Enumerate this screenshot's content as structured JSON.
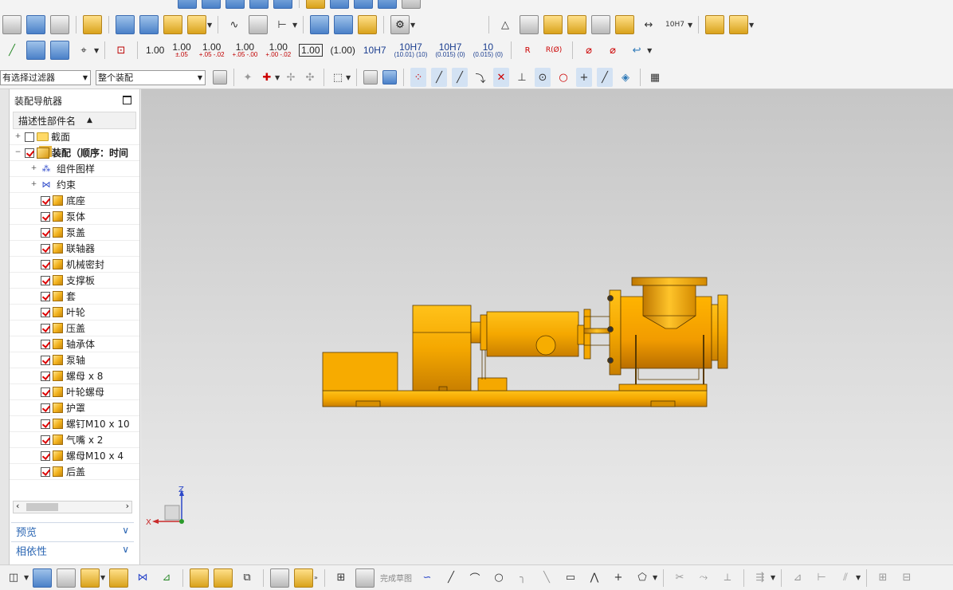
{
  "toolbar": {
    "row1_icons": [
      "sheet-icon",
      "book-icon",
      "layers-icon",
      "cube-blue-icon",
      "cube-blue-icon",
      "cube-blue-icon",
      "sheet-icon",
      "gold-cube-icon",
      "gold-cube-icon",
      "view-icon",
      "view-icon"
    ],
    "row2_tolerance_label": "10H7",
    "row3_tolerances": [
      {
        "main": "1.00",
        "sub": ""
      },
      {
        "main": "1.00",
        "sub": "±.05"
      },
      {
        "main": "1.00",
        "sub": "+.05 -.02"
      },
      {
        "main": "1.00",
        "sub": "+.05 -.00"
      },
      {
        "main": "1.00",
        "sub": "+.00 -.02"
      },
      {
        "main": "1.00",
        "sub": ""
      },
      {
        "main": "(1.00)",
        "sub": ""
      },
      {
        "main": "10H7",
        "sub": ""
      },
      {
        "main": "10H7",
        "sub": "(10.01) (10)"
      },
      {
        "main": "10H7",
        "sub": "(0.015) (0)"
      },
      {
        "main": "10",
        "sub": "(0.015) (0)"
      }
    ],
    "radius_labels": [
      "R",
      "R(Ø)"
    ],
    "filter_select": "有选择过滤器",
    "scope_select": "整个装配"
  },
  "navigator": {
    "title": "装配导航器",
    "column_header": "描述性部件名",
    "items": [
      {
        "label": "截面",
        "checked": false,
        "icon": "folder-icon",
        "expander": "+",
        "indent": 0
      },
      {
        "label": "装配（顺序：时间",
        "checked": true,
        "icon": "assembly-icon",
        "expander": "−",
        "indent": 0,
        "bold": true
      },
      {
        "label": "组件图样",
        "checked": null,
        "icon": "component-pattern-icon",
        "expander": "+",
        "indent": 1
      },
      {
        "label": "约束",
        "checked": null,
        "icon": "constraint-icon",
        "expander": "+",
        "indent": 1
      },
      {
        "label": "底座",
        "checked": true,
        "icon": "part-icon",
        "indent": 1
      },
      {
        "label": "泵体",
        "checked": true,
        "icon": "part-icon",
        "indent": 1
      },
      {
        "label": "泵盖",
        "checked": true,
        "icon": "part-icon",
        "indent": 1
      },
      {
        "label": "联轴器",
        "checked": true,
        "icon": "part-icon",
        "indent": 1
      },
      {
        "label": "机械密封",
        "checked": true,
        "icon": "part-icon",
        "indent": 1
      },
      {
        "label": "支撑板",
        "checked": true,
        "icon": "part-icon",
        "indent": 1
      },
      {
        "label": "套",
        "checked": true,
        "icon": "part-icon",
        "indent": 1
      },
      {
        "label": "叶轮",
        "checked": true,
        "icon": "part-icon",
        "indent": 1
      },
      {
        "label": "压盖",
        "checked": true,
        "icon": "part-icon",
        "indent": 1
      },
      {
        "label": "轴承体",
        "checked": true,
        "icon": "part-icon",
        "indent": 1
      },
      {
        "label": "泵轴",
        "checked": true,
        "icon": "part-icon",
        "indent": 1
      },
      {
        "label": "螺母 x 8",
        "checked": true,
        "icon": "part-icon",
        "indent": 1
      },
      {
        "label": "叶轮螺母",
        "checked": true,
        "icon": "part-icon",
        "indent": 1
      },
      {
        "label": "护罩",
        "checked": true,
        "icon": "part-icon",
        "indent": 1
      },
      {
        "label": "螺钉M10 x 10",
        "checked": true,
        "icon": "part-icon",
        "indent": 1
      },
      {
        "label": "气嘴 x 2",
        "checked": true,
        "icon": "part-icon",
        "indent": 1
      },
      {
        "label": "螺母M10 x 4",
        "checked": true,
        "icon": "part-icon",
        "indent": 1
      },
      {
        "label": "后盖",
        "checked": true,
        "icon": "part-icon",
        "indent": 1
      }
    ],
    "panels": [
      "预览",
      "相依性"
    ]
  },
  "viewport": {
    "triad": {
      "x_label": "X",
      "z_label": "Z"
    },
    "model_color": "#f5a800"
  },
  "bottom_bar": {
    "finish_sketch_label": "完成草图"
  },
  "colors": {
    "accent_blue": "#2b66b3",
    "check_red": "#d00000",
    "part_gold": "#f2b21c"
  }
}
